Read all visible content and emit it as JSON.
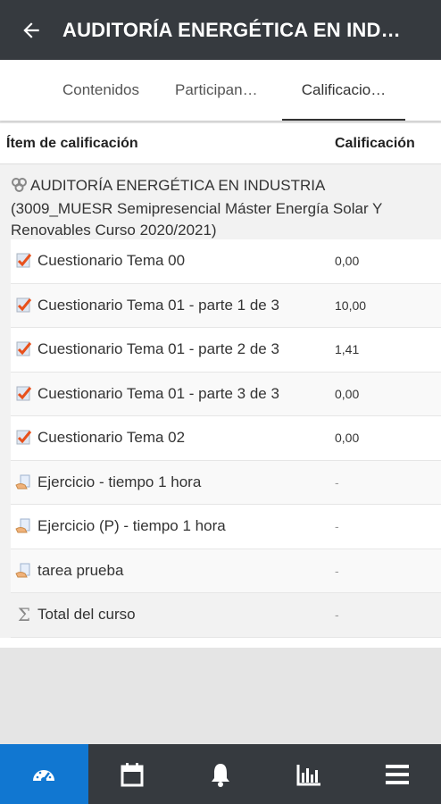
{
  "header": {
    "title": "AUDITORÍA ENERGÉTICA EN INDUSTRIA",
    "back_icon": "arrow-back-icon"
  },
  "tabs": [
    {
      "label": "Contenidos",
      "active": false
    },
    {
      "label": "Participan…",
      "active": false
    },
    {
      "label": "Calificacio…",
      "active": true
    }
  ],
  "table": {
    "headers": {
      "item": "Ítem de calificación",
      "grade": "Calificación"
    },
    "course": {
      "name": "AUDITORÍA ENERGÉTICA EN INDUSTRIA (3009_MUESR Semipresencial Máster Energía Solar Y Renovables Curso 2020/2021)",
      "icon": "category-icon"
    },
    "rows": [
      {
        "name": "Cuestionario Tema 00",
        "grade": "0,00",
        "icon": "quiz-icon"
      },
      {
        "name": "Cuestionario Tema 01 - parte 1 de 3",
        "grade": "10,00",
        "icon": "quiz-icon"
      },
      {
        "name": "Cuestionario Tema 01 - parte 2 de 3",
        "grade": "1,41",
        "icon": "quiz-icon"
      },
      {
        "name": "Cuestionario Tema 01 - parte 3 de 3",
        "grade": "0,00",
        "icon": "quiz-icon"
      },
      {
        "name": "Cuestionario Tema 02",
        "grade": "0,00",
        "icon": "quiz-icon"
      },
      {
        "name": "Ejercicio - tiempo 1 hora",
        "grade": "-",
        "icon": "assignment-icon"
      },
      {
        "name": "Ejercicio (P) - tiempo 1 hora",
        "grade": "-",
        "icon": "assignment-icon"
      },
      {
        "name": "tarea prueba",
        "grade": "-",
        "icon": "assignment-icon"
      }
    ],
    "total": {
      "name": "Total del curso",
      "grade": "-",
      "icon": "sigma-icon"
    }
  },
  "bottom_nav": [
    {
      "icon": "dashboard-icon",
      "active": true
    },
    {
      "icon": "calendar-icon",
      "active": false
    },
    {
      "icon": "bell-icon",
      "active": false
    },
    {
      "icon": "grades-chart-icon",
      "active": false
    },
    {
      "icon": "menu-icon",
      "active": false
    }
  ],
  "colors": {
    "appbar": "#363a3f",
    "active_nav": "#1177d1",
    "quiz_check": "#e8511c"
  }
}
